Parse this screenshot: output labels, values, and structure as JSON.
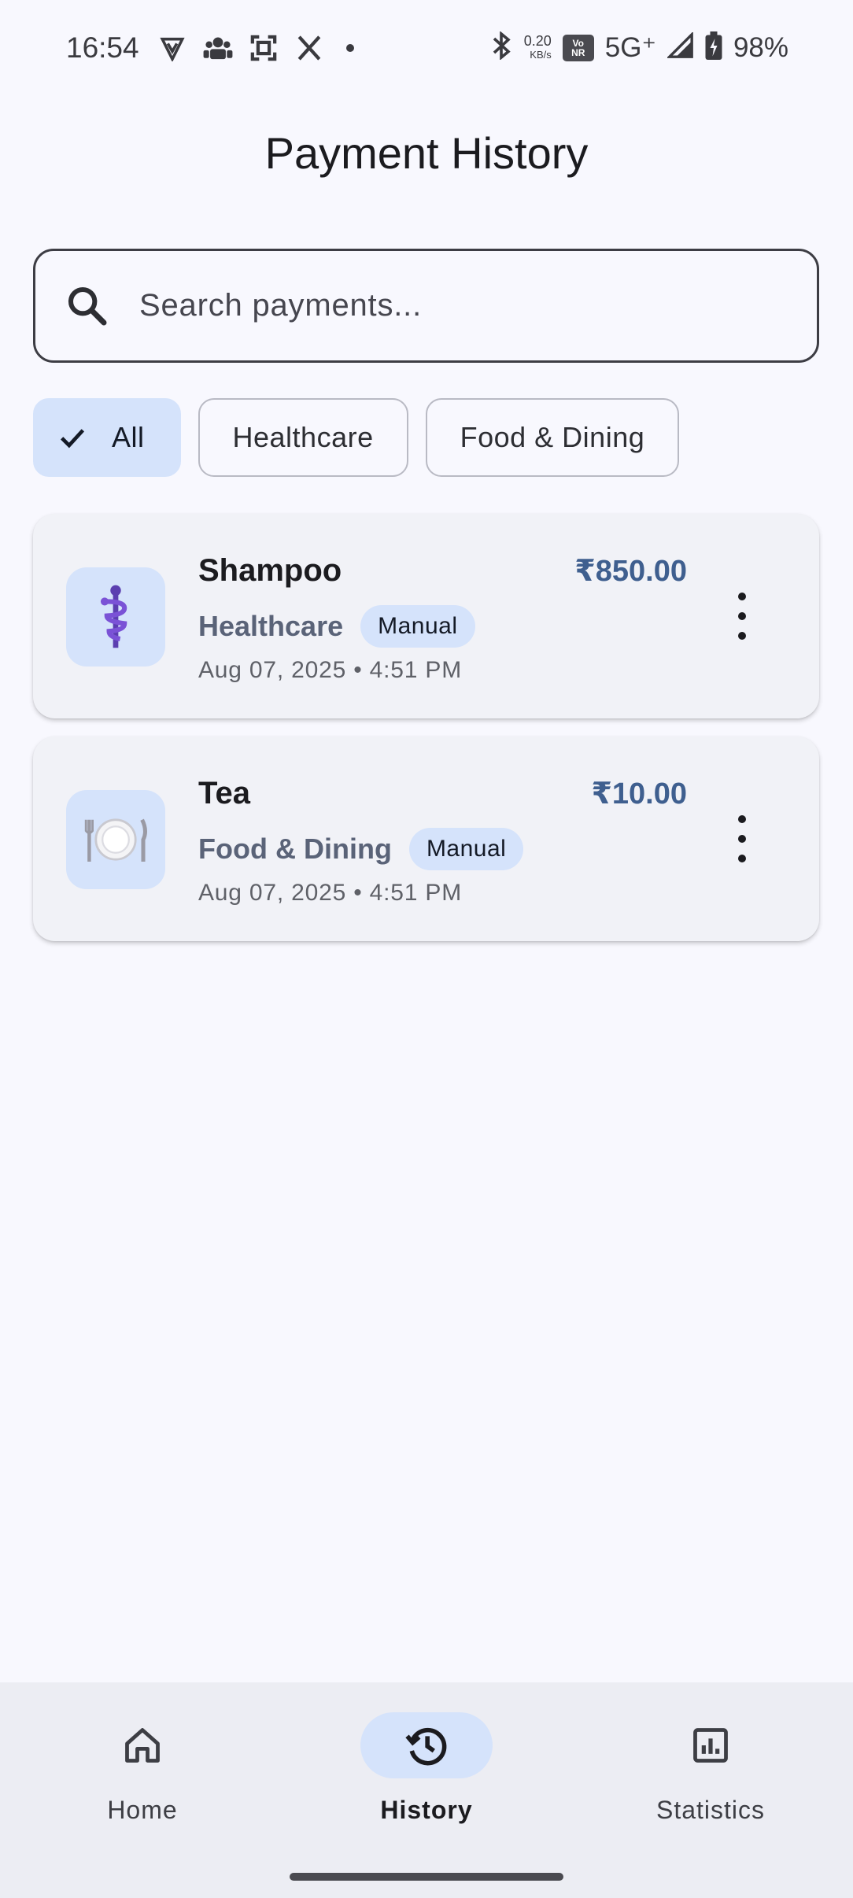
{
  "status_bar": {
    "time": "16:54",
    "net_speed_value": "0.20",
    "net_speed_unit": "KB/s",
    "vonr_top": "Vo",
    "vonr_bottom": "NR",
    "network": "5G⁺",
    "battery": "98%",
    "icons_left": [
      "shield-v-icon",
      "people-icon",
      "scan-icon",
      "x-logo-icon",
      "dot"
    ],
    "icons_right": [
      "bluetooth-icon",
      "signal-icon",
      "battery-charging-icon"
    ]
  },
  "header": {
    "title": "Payment History"
  },
  "search": {
    "placeholder": "Search payments...",
    "value": ""
  },
  "filters": {
    "chips": [
      {
        "label": "All",
        "selected": true
      },
      {
        "label": "Healthcare",
        "selected": false
      },
      {
        "label": "Food & Dining",
        "selected": false
      }
    ]
  },
  "payments": [
    {
      "title": "Shampoo",
      "amount": "₹850.00",
      "category": "Healthcare",
      "badge": "Manual",
      "date": "Aug 07, 2025 • 4:51 PM",
      "icon": "medical-symbol-icon",
      "emoji": "⚕️"
    },
    {
      "title": "Tea",
      "amount": "₹10.00",
      "category": "Food & Dining",
      "badge": "Manual",
      "date": "Aug 07, 2025 • 4:51 PM",
      "icon": "plate-cutlery-icon",
      "emoji": "🍽️"
    }
  ],
  "bottom_nav": {
    "items": [
      {
        "label": "Home",
        "icon": "home-icon",
        "active": false
      },
      {
        "label": "History",
        "icon": "history-icon",
        "active": true
      },
      {
        "label": "Statistics",
        "icon": "statistics-icon",
        "active": false
      }
    ]
  },
  "colors": {
    "background": "#f8f8fe",
    "accent_container": "#d5e3fb",
    "amount": "#3f5f8f",
    "card": "#f1f2f7",
    "nav": "#ecedf3"
  }
}
